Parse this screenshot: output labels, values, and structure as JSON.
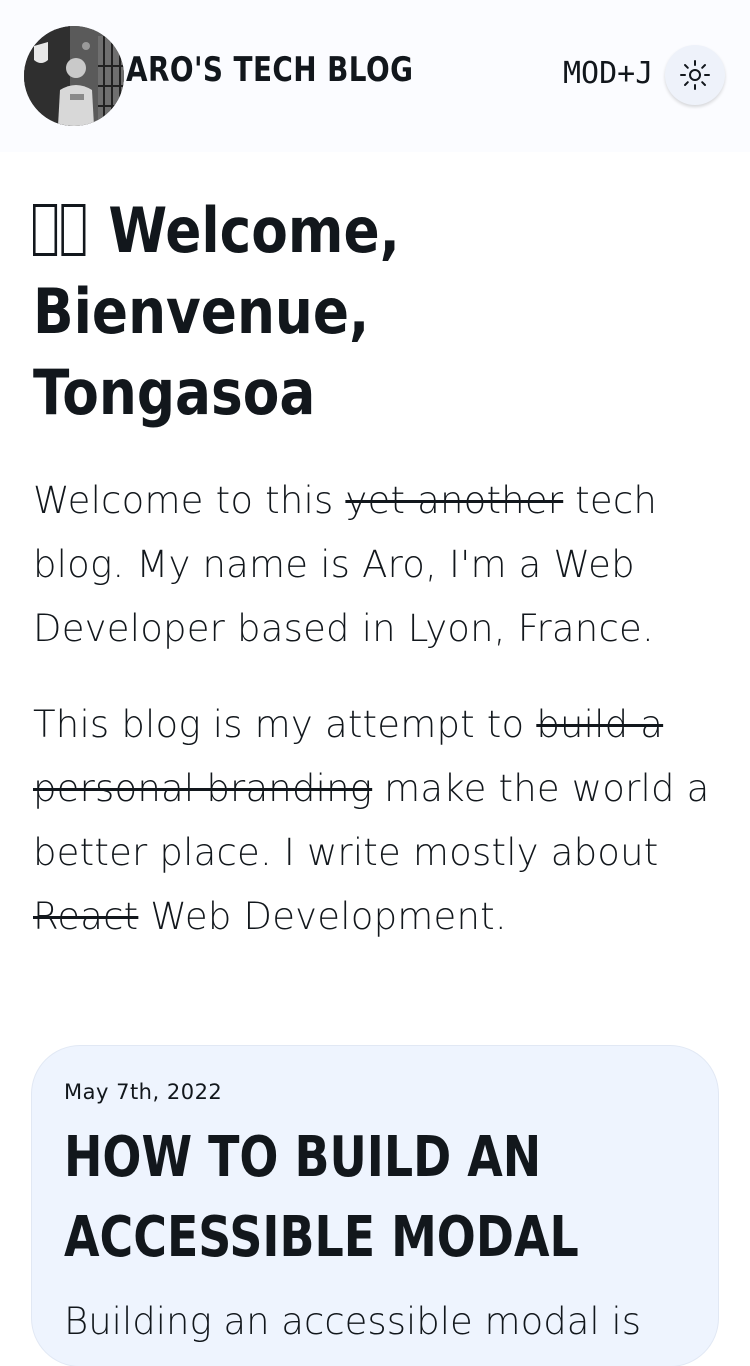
{
  "header": {
    "site_title": "Aro's Tech Blog",
    "shortcut": "MOD+J",
    "theme_toggle_icon": "sun-icon",
    "avatar_icon": "author-avatar"
  },
  "hero": {
    "greeting_icon": "waving-hand-icon",
    "line1": "Welcome,",
    "line2": "Bienvenue,",
    "line3": "Tongasoa"
  },
  "intro": {
    "p1_before": "Welcome to this ",
    "p1_struck": "yet another",
    "p1_after": " tech blog. My name is Aro, I'm a Web Developer based in Lyon, France.",
    "p2_before": "This blog is my attempt to ",
    "p2_struck1": "build a personal branding",
    "p2_middle": " make the world a better place. I write mostly about ",
    "p2_struck2": "React",
    "p2_after": " Web Development."
  },
  "posts": [
    {
      "date": "May 7th, 2022",
      "title_line1": "How to build an",
      "title_line2": "accessible modal",
      "excerpt": "Building an accessible modal is"
    }
  ],
  "colors": {
    "text": "#12171c",
    "header_bg": "#fbfcff",
    "card_bg": "#eef4fe",
    "toggle_bg": "#eef2fa"
  }
}
